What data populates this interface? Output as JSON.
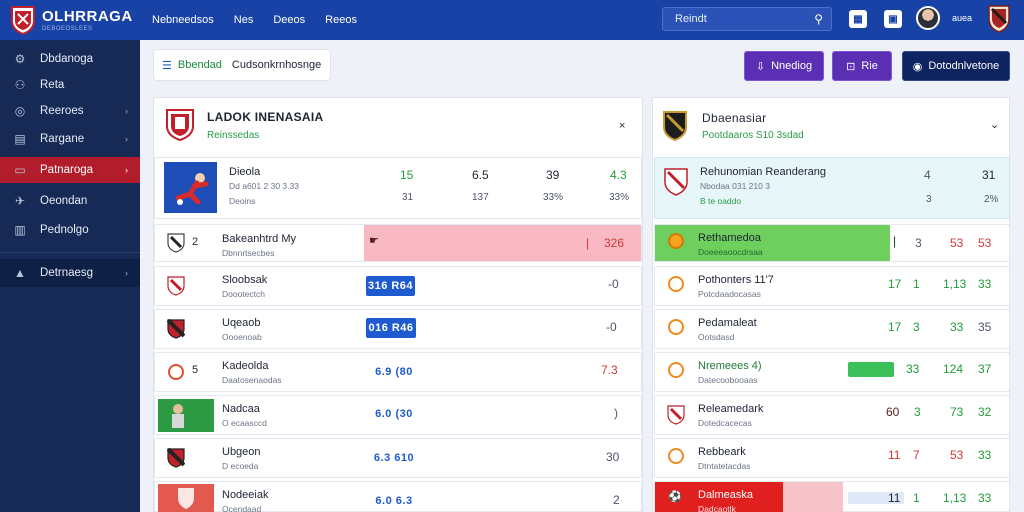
{
  "app": {
    "name": "OLHRRAGA",
    "tagline": "DEBOEOSLEES"
  },
  "topnav": [
    "Nebneedsos",
    "Nes",
    "Deeos",
    "Reeos"
  ],
  "search": {
    "value": "Reindt"
  },
  "user": {
    "name": "auea"
  },
  "sidebar": {
    "items": [
      {
        "label": "Dbdanoga"
      },
      {
        "label": "Reta"
      },
      {
        "label": "Reeroes"
      },
      {
        "label": "Rargane"
      },
      {
        "label": "Patnaroga"
      },
      {
        "label": "Oeondan"
      },
      {
        "label": "Pednolgo"
      },
      {
        "label": "Detrnaesg"
      }
    ]
  },
  "toolbar": {
    "view_a": "Bbendad",
    "view_b": "Cudsonkrnhosnge",
    "btn1": "Nnediog",
    "btn2": "Rie",
    "btn3": "Dotodnlvetone"
  },
  "left_panel": {
    "title": "LADOK INENASAIA",
    "subtitle": "Reinssedas",
    "close": "×",
    "featured": {
      "name": "Dieola",
      "sub": "Dd a601 2 30  3.33",
      "sub2": "Deoins",
      "c1": "15",
      "c1b": "31",
      "c2": "6.5",
      "c2b": "137",
      "c3": "39",
      "c3b": "33%",
      "c4": "4.3",
      "c4b": "33%"
    },
    "rows": [
      {
        "rank": "2",
        "name": "Bakeanhtrd My",
        "sub": "Dbnnrtsecbes",
        "value": "326"
      },
      {
        "name": "Sloobsak",
        "sub": "Doootectch",
        "pill": "316 R64",
        "value": "-0"
      },
      {
        "name": "Uqeaob",
        "sub": "Oooenoab",
        "pill": "016 R46",
        "value": "-0"
      },
      {
        "rank": "5",
        "name": "Kadeolda",
        "sub": "Daatosenaodas",
        "pill": "6.9 (80",
        "value": "7.3"
      },
      {
        "name": "Nadcaa",
        "sub": "O ecaasccd",
        "pill": "6.0 (30",
        "value": ")"
      },
      {
        "name": "Ubgeon",
        "sub": "D ecoeda",
        "pill": "6.3 610",
        "value": "30"
      },
      {
        "name": "Nodeeiak",
        "sub": "Ocendaad",
        "pill": "6.0 6.3",
        "value": "2"
      }
    ]
  },
  "right_panel": {
    "title": "Dbaenasiar",
    "subtitle": "Pootdaaros S10 3sdad",
    "toggle": "⌄",
    "featured": {
      "name": "Rehunomian Reanderang",
      "sub": "Nbodaa 031 210 3",
      "sub2": "B te oaddo",
      "c1": "4",
      "c1b": "3",
      "c2": "31",
      "c2b": "2%"
    },
    "rows": [
      {
        "name": "Rethamedoa",
        "sub": "Doeeeaoocdrsaa",
        "a": "3",
        "b": "53",
        "c": "53",
        "fill": 0.82
      },
      {
        "name": "Pothonters 11'7",
        "sub": "Potcdaadocasas",
        "a": "17",
        "b": "1",
        "c": "1,13",
        "d": "33"
      },
      {
        "name": "Pedamaleat",
        "sub": "Ootsdasd",
        "a": "17",
        "b": "3",
        "c": "33",
        "d": "35"
      },
      {
        "name": "Nremeees 4)",
        "sub": "Datecoobooaas",
        "a": "33",
        "c": "124",
        "d": "37"
      },
      {
        "name": "Releamedark",
        "sub": "Dotedcacecas",
        "a": "60",
        "b": "3",
        "c": "73",
        "d": "32"
      },
      {
        "name": "Rebbeark",
        "sub": "Dtntatetacdas",
        "a": "11",
        "b": "7",
        "c": "53",
        "d": "33"
      },
      {
        "name": "Dalmeaska",
        "sub": "Dadcaotlk",
        "a": "11",
        "b": "1",
        "c": "1,13",
        "d": "33"
      }
    ]
  }
}
